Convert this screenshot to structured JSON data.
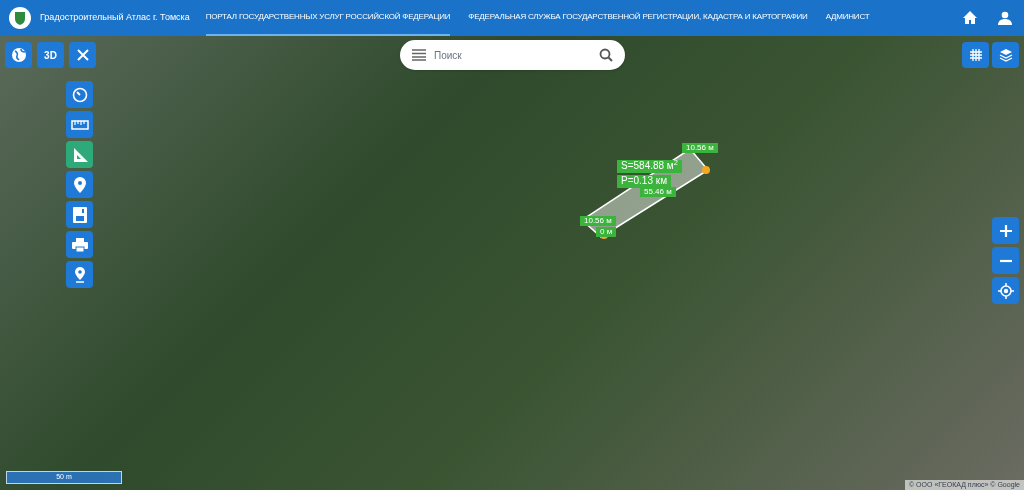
{
  "header": {
    "title": "Градостроительный Атлас г. Томска",
    "links": [
      {
        "label": "ПОРТАЛ ГОСУДАРСТВЕННЫХ УСЛУГ РОССИЙСКОЙ ФЕДЕРАЦИИ",
        "selected": true
      },
      {
        "label": "ФЕДЕРАЛЬНАЯ СЛУЖБА ГОСУДАРСТВЕННОЙ РЕГИСТРАЦИИ, КАДАСТРА И КАРТОГРАФИИ",
        "selected": false
      },
      {
        "label": "АДМИНИСТ",
        "selected": false
      }
    ]
  },
  "search": {
    "placeholder": "Поиск"
  },
  "top_buttons": [
    {
      "kind": "globe"
    },
    {
      "kind": "text",
      "label": "3D"
    },
    {
      "kind": "close"
    }
  ],
  "tools": [
    {
      "kind": "clock",
      "selected": false
    },
    {
      "kind": "ruler",
      "selected": false
    },
    {
      "kind": "triangle",
      "selected": true
    },
    {
      "kind": "pin",
      "selected": false
    },
    {
      "kind": "save",
      "selected": false
    },
    {
      "kind": "print",
      "selected": false
    },
    {
      "kind": "marker",
      "selected": false
    }
  ],
  "measurement": {
    "labels": [
      {
        "kind": "side",
        "text": "10.56 м"
      },
      {
        "kind": "area",
        "text": "S=584.88 м$^{2}$"
      },
      {
        "kind": "perimeter",
        "text": "P=0.13 км"
      },
      {
        "kind": "length",
        "text": "55.46 м"
      },
      {
        "kind": "side2",
        "text": "10.56 м"
      },
      {
        "kind": "zero",
        "text": "0 м"
      }
    ]
  },
  "scale": "50 m",
  "attribution": "© ООО «ГЕОКАД плюс» © Google"
}
